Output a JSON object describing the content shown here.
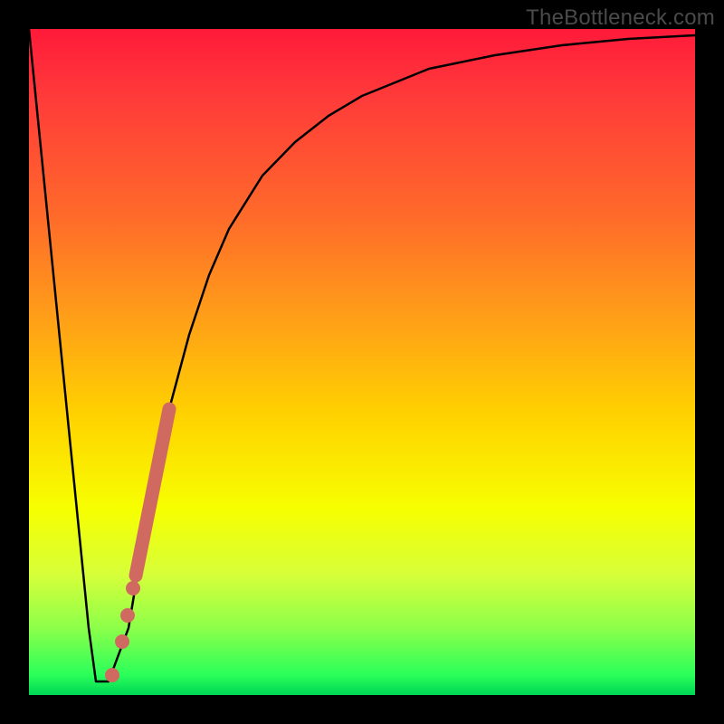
{
  "watermark": "TheBottleneck.com",
  "chart_data": {
    "type": "line",
    "title": "",
    "xlabel": "",
    "ylabel": "",
    "xlim": [
      0,
      100
    ],
    "ylim": [
      0,
      100
    ],
    "grid": false,
    "legend": false,
    "series": [
      {
        "name": "bottleneck-curve",
        "x": [
          0,
          3,
          6,
          9,
          10,
          12,
          15,
          18,
          21,
          24,
          27,
          30,
          35,
          40,
          45,
          50,
          55,
          60,
          70,
          80,
          90,
          100
        ],
        "y": [
          100,
          70,
          40,
          10,
          2,
          2,
          10,
          28,
          43,
          54,
          63,
          70,
          78,
          83,
          87,
          90,
          92,
          94,
          96,
          97.5,
          98.5,
          99
        ]
      }
    ],
    "highlight_segment": {
      "name": "highlight-band",
      "x_start": 16,
      "x_end": 21,
      "y_start": 18,
      "y_end": 43
    },
    "highlight_points": [
      {
        "x": 14.0,
        "y": 8
      },
      {
        "x": 14.8,
        "y": 12
      },
      {
        "x": 15.6,
        "y": 16
      },
      {
        "x": 12.5,
        "y": 3
      }
    ]
  },
  "colors": {
    "frame": "#000000",
    "curve": "#000000",
    "highlight": "#d06a60",
    "gradient_top": "#ff1a3a",
    "gradient_bottom": "#00d555",
    "watermark": "#4a4a4a"
  }
}
